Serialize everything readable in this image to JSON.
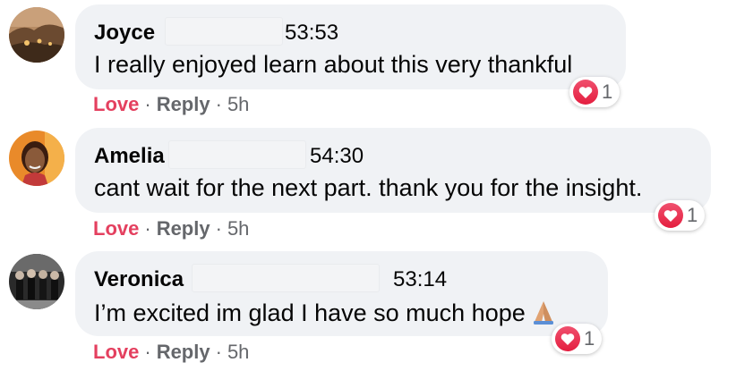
{
  "comments": [
    {
      "author": "Joyce",
      "timestamp": "53:53",
      "text": "I really enjoyed learn about this very thankful",
      "reaction_count": "1",
      "love_label": "Love",
      "reply_label": "Reply",
      "separator": "·",
      "age": "5h",
      "avatar": "landscape-avatar"
    },
    {
      "author": "Amelia",
      "timestamp": "54:30",
      "text": "cant wait for the next part. thank you for the insight.",
      "reaction_count": "1",
      "love_label": "Love",
      "reply_label": "Reply",
      "separator": "·",
      "age": "5h",
      "avatar": "portrait-avatar"
    },
    {
      "author": "Veronica",
      "timestamp": "53:14",
      "text": "I’m excited im glad I have so much hope",
      "emoji": "folded-hands-icon",
      "reaction_count": "1",
      "love_label": "Love",
      "reply_label": "Reply",
      "separator": "·",
      "age": "5h",
      "avatar": "group-photo-avatar"
    }
  ],
  "colors": {
    "bubble": "#f0f2f5",
    "love": "#e4405f",
    "meta": "#65676b",
    "heart": "#e41e3f"
  }
}
